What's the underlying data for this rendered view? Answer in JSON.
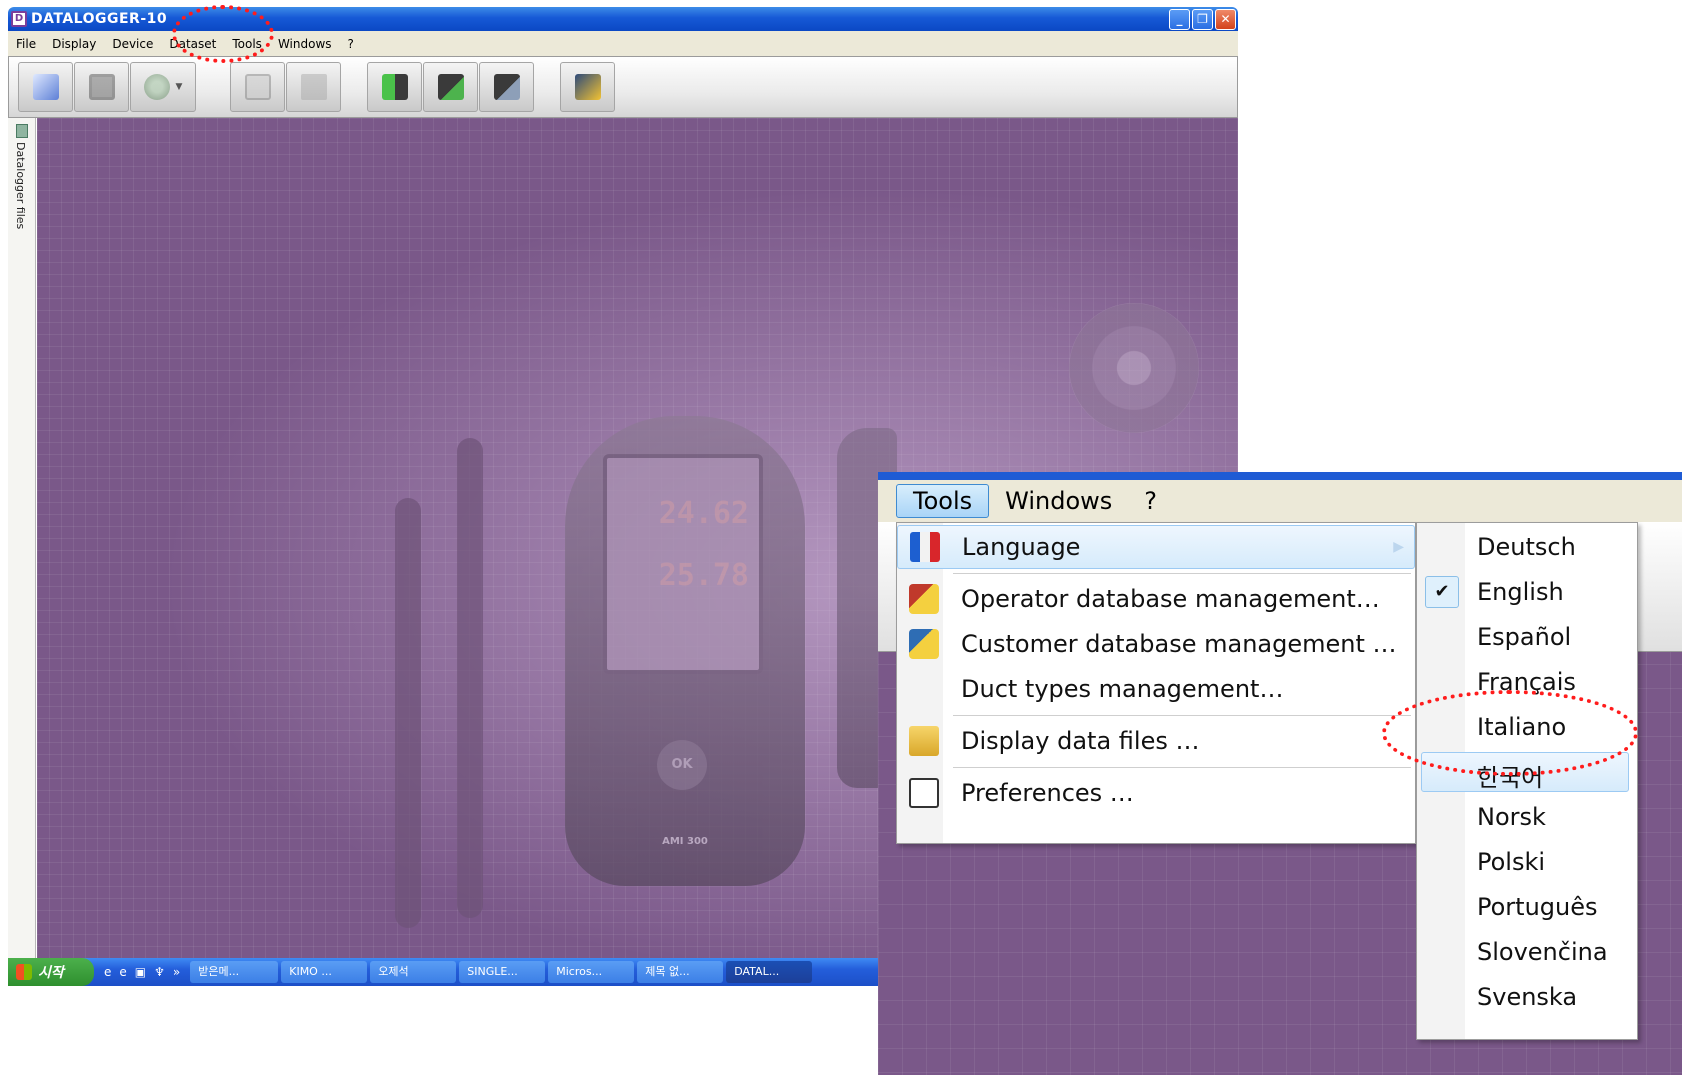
{
  "window": {
    "title": "DATALOGGER-10",
    "buttons": {
      "minimize": "_",
      "restore": "❐",
      "close": "✕"
    }
  },
  "menubar": [
    "File",
    "Display",
    "Device",
    "Dataset",
    "Tools",
    "Windows",
    "?"
  ],
  "toolbar": {
    "buttons": [
      {
        "icon": "new-file-icon",
        "disabled": false
      },
      {
        "icon": "save-icon",
        "disabled": true
      },
      {
        "icon": "settings-gear-icon",
        "disabled": true,
        "dropdown": true
      },
      {
        "icon": "print-preview-icon",
        "disabled": true
      },
      {
        "icon": "print-icon",
        "disabled": true
      },
      {
        "icon": "download-icon",
        "disabled": false
      },
      {
        "icon": "device-check-icon",
        "disabled": false
      },
      {
        "icon": "device-database-icon",
        "disabled": false
      },
      {
        "icon": "tools-icon",
        "disabled": false
      }
    ]
  },
  "side_panel": {
    "label": "Datalogger files"
  },
  "device_graphic": {
    "reading1": "24.62",
    "reading2": "25.78",
    "ok_label": "OK",
    "model": "AMI 300"
  },
  "taskbar": {
    "start_label": "시작",
    "tasks": [
      "받은메...",
      "KIMO ...",
      "오제석",
      "SINGLE...",
      "Micros...",
      "제목 없...",
      "DATAL..."
    ]
  },
  "inset": {
    "menubar": {
      "tools": "Tools",
      "windows": "Windows",
      "help": "?"
    },
    "tools_menu": [
      {
        "label": "Language",
        "icon": "language-flags-icon",
        "has_submenu": true
      },
      {
        "label": "Operator database management…",
        "icon": "operator-db-icon"
      },
      {
        "label": "Customer database management …",
        "icon": "customer-db-icon"
      },
      {
        "label": "Duct types management…",
        "icon": ""
      },
      {
        "label": "Display data files …",
        "icon": "data-files-icon"
      },
      {
        "label": "Preferences …",
        "icon": "preferences-icon"
      }
    ],
    "language_submenu": [
      "Deutsch",
      "English",
      "Español",
      "Français",
      "Italiano",
      "한국어",
      "Norsk",
      "Polski",
      "Português",
      "Slovenčina",
      "Svenska"
    ],
    "checked_language": "English",
    "highlighted_language": "한국어"
  },
  "colors": {
    "workspace": "#7a5889",
    "annotation": "#ff1c1c",
    "titlebar": "#1659d6"
  }
}
